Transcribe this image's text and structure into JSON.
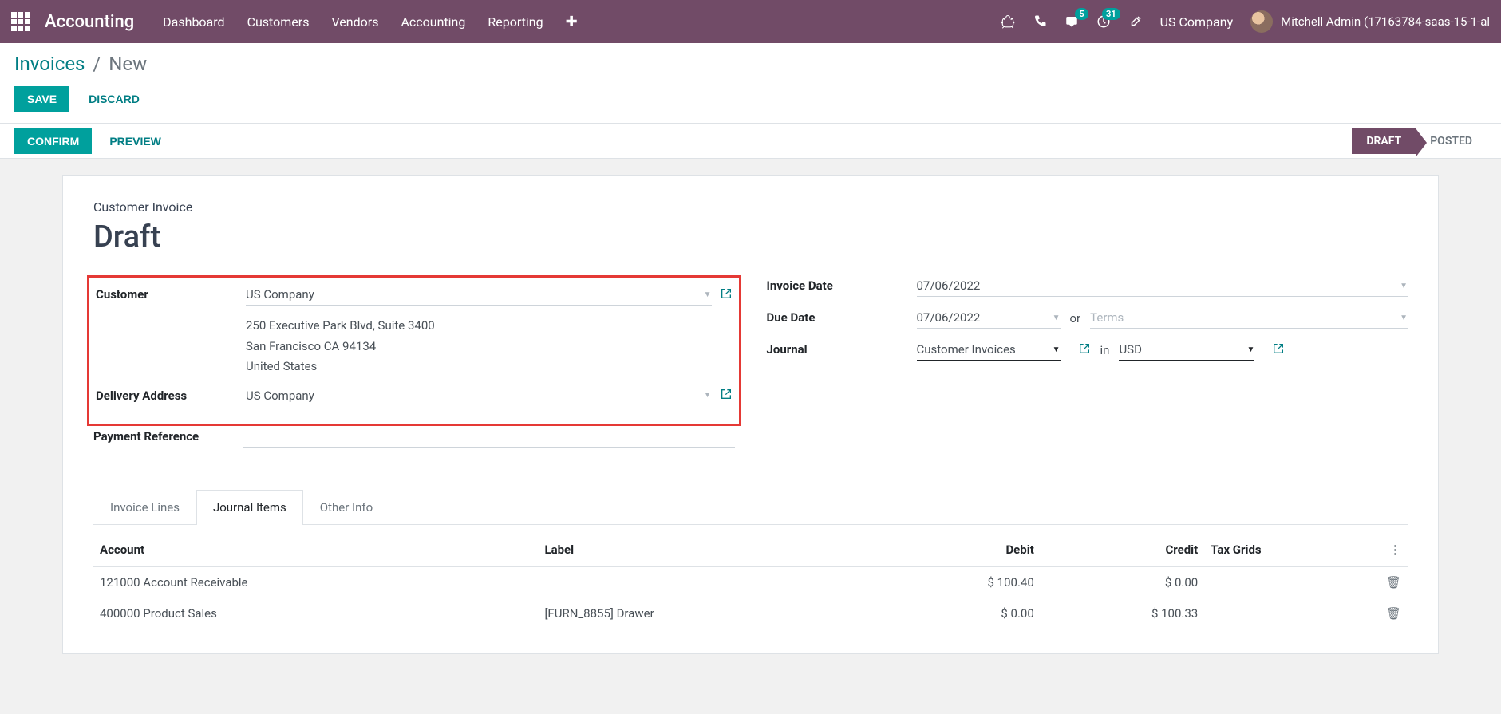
{
  "topnav": {
    "brand": "Accounting",
    "links": [
      "Dashboard",
      "Customers",
      "Vendors",
      "Accounting",
      "Reporting"
    ],
    "messages_badge": "5",
    "activities_badge": "31",
    "company": "US Company",
    "user": "Mitchell Admin (17163784-saas-15-1-al"
  },
  "breadcrumb": {
    "parent": "Invoices",
    "current": "New"
  },
  "actions": {
    "save": "SAVE",
    "discard": "DISCARD",
    "confirm": "CONFIRM",
    "preview": "PREVIEW"
  },
  "status": {
    "draft": "DRAFT",
    "posted": "POSTED"
  },
  "form": {
    "subtitle": "Customer Invoice",
    "title": "Draft",
    "labels": {
      "customer": "Customer",
      "delivery": "Delivery Address",
      "payref": "Payment Reference",
      "invoice_date": "Invoice Date",
      "due_date": "Due Date",
      "journal": "Journal"
    },
    "customer": "US Company",
    "address_l1": "250 Executive Park Blvd, Suite 3400",
    "address_l2": "San Francisco CA 94134",
    "address_l3": "United States",
    "delivery": "US Company",
    "invoice_date": "07/06/2022",
    "due_date": "07/06/2022",
    "due_or": "or",
    "terms_placeholder": "Terms",
    "journal": "Customer Invoices",
    "journal_in": "in",
    "currency": "USD"
  },
  "tabs": [
    "Invoice Lines",
    "Journal Items",
    "Other Info"
  ],
  "table": {
    "headers": [
      "Account",
      "Label",
      "Debit",
      "Credit",
      "Tax Grids"
    ],
    "rows": [
      {
        "account": "121000 Account Receivable",
        "label": "",
        "debit": "$ 100.40",
        "credit": "$ 0.00",
        "tax": ""
      },
      {
        "account": "400000 Product Sales",
        "label": "[FURN_8855] Drawer",
        "debit": "$ 0.00",
        "credit": "$ 100.33",
        "tax": ""
      }
    ]
  }
}
